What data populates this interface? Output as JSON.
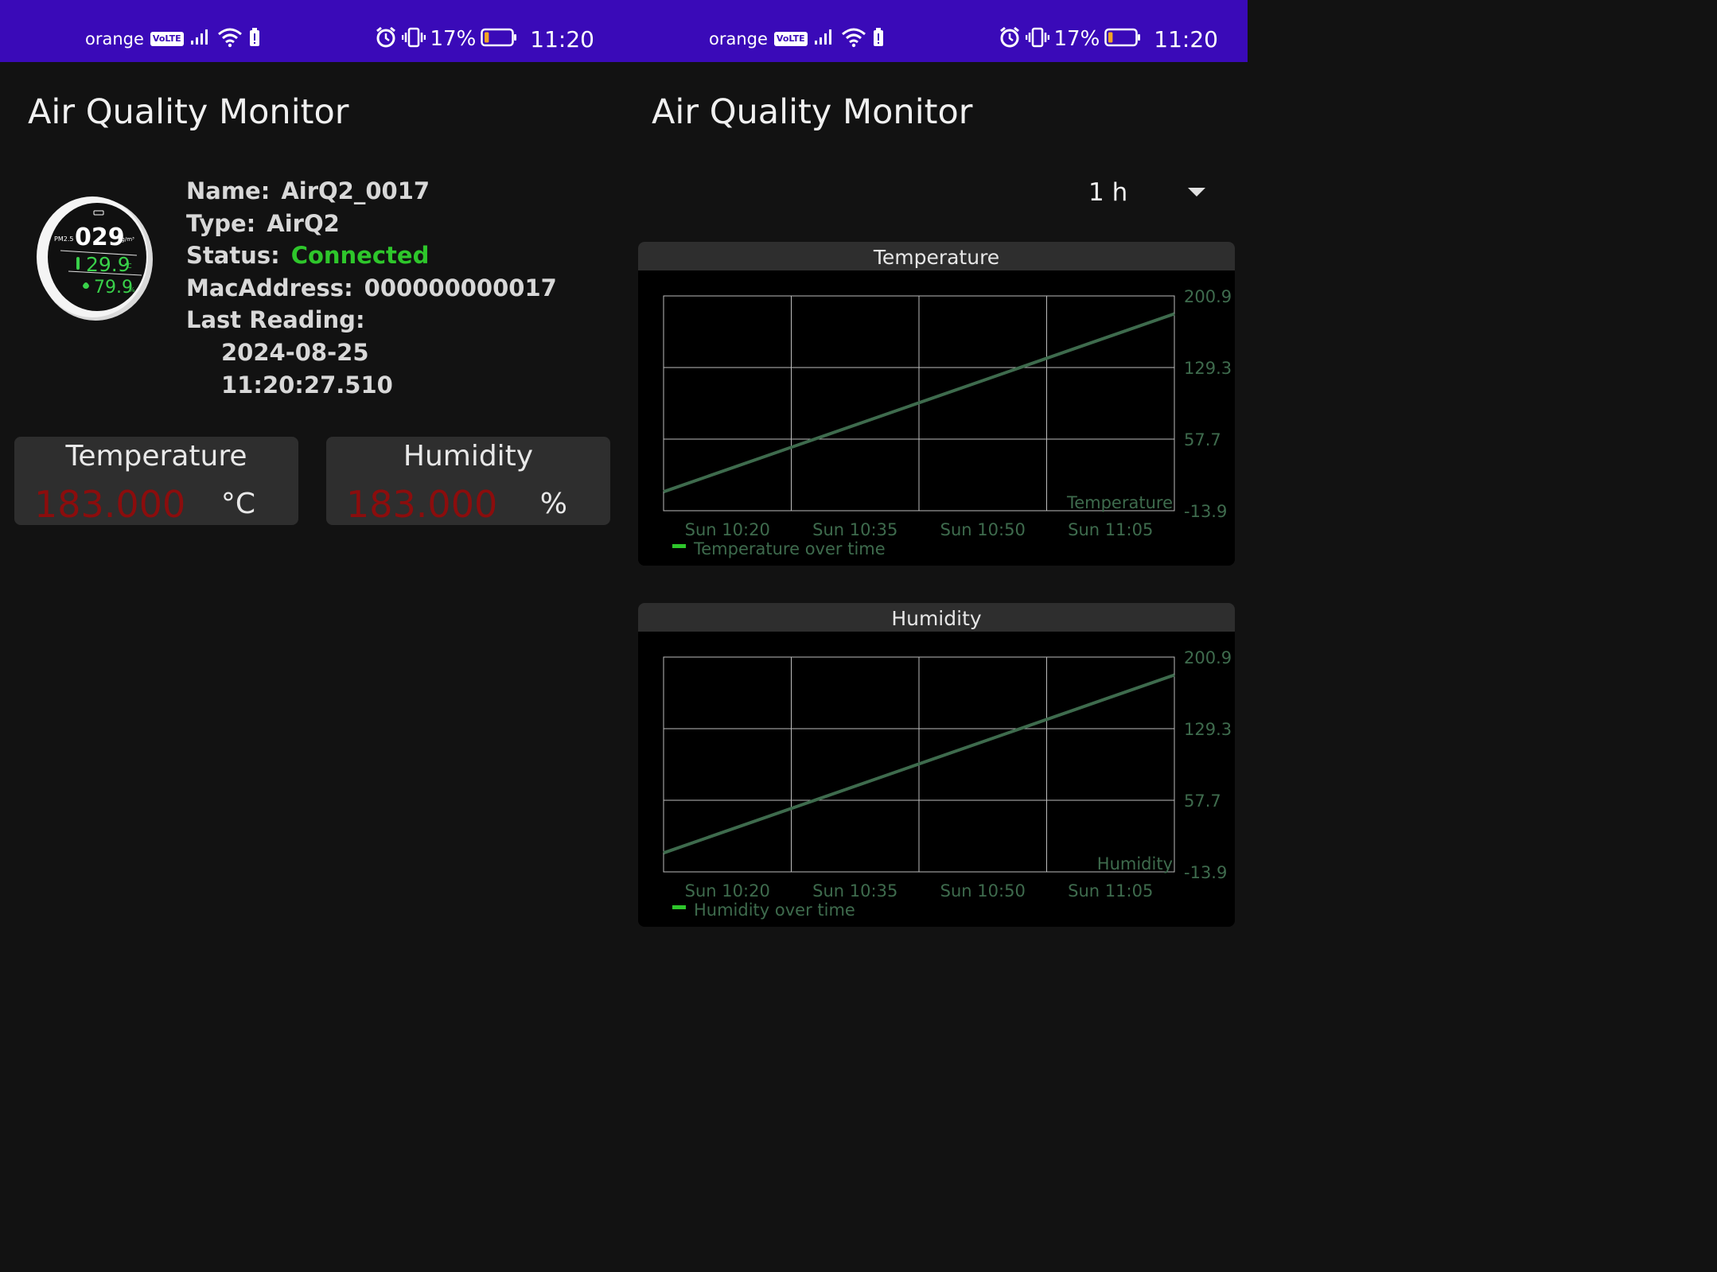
{
  "status_bar": {
    "carrier": "orange",
    "volte": "VoLTE",
    "battery_percent": "17%",
    "time": "11:20",
    "battery_level": 0.17,
    "icons": [
      "signal-icon",
      "wifi-icon",
      "battery-saver-icon",
      "alarm-icon",
      "vibrate-icon",
      "battery-icon"
    ]
  },
  "app": {
    "title": "Air Quality Monitor"
  },
  "device": {
    "name_label": "Name:",
    "name": "AirQ2_0017",
    "type_label": "Type:",
    "type": "AirQ2",
    "status_label": "Status:",
    "status": "Connected",
    "mac_label": "MacAddress:",
    "mac": "000000000017",
    "last_reading_label": "Last Reading:",
    "last_reading_date": "2024-08-25",
    "last_reading_time": "11:20:27.510",
    "status_color": "#2ec62b",
    "image": {
      "pm_label": "PM2.5",
      "pm_value": "029",
      "pm_unit": "ug/m³",
      "temp_value": "29.9",
      "temp_unit": "°C",
      "humidity_value": "79.9",
      "humidity_unit": "%"
    }
  },
  "cards": {
    "temperature": {
      "title": "Temperature",
      "value": "183.000",
      "unit": "°C"
    },
    "humidity": {
      "title": "Humidity",
      "value": "183.000",
      "unit": "%"
    },
    "value_color": "#8b0d0d"
  },
  "range_select": {
    "value": "1 h"
  },
  "chart_data": [
    {
      "type": "line",
      "title": "Temperature",
      "x_ticks": [
        "Sun 10:20",
        "Sun 10:35",
        "Sun 10:50",
        "Sun 11:05"
      ],
      "y_ticks": [
        "200.9",
        "129.3",
        "57.7",
        "-13.9"
      ],
      "ylim": [
        -13.9,
        200.9
      ],
      "xlim": [
        "Sun 10:20",
        "Sun 11:20"
      ],
      "series": [
        {
          "name": "Temperature",
          "x": [
            "Sun 10:20",
            "Sun 11:20"
          ],
          "values": [
            5.0,
            183.0
          ],
          "color": "#3e6b4d"
        }
      ],
      "series_label": "Temperature",
      "legend": "Temperature over time",
      "legend_position": "bottom-left",
      "legend_color": "#2ec62b",
      "grid": true
    },
    {
      "type": "line",
      "title": "Humidity",
      "x_ticks": [
        "Sun 10:20",
        "Sun 10:35",
        "Sun 10:50",
        "Sun 11:05"
      ],
      "y_ticks": [
        "200.9",
        "129.3",
        "57.7",
        "-13.9"
      ],
      "ylim": [
        -13.9,
        200.9
      ],
      "xlim": [
        "Sun 10:20",
        "Sun 11:20"
      ],
      "series": [
        {
          "name": "Humidity",
          "x": [
            "Sun 10:20",
            "Sun 11:20"
          ],
          "values": [
            5.0,
            183.0
          ],
          "color": "#3e6b4d"
        }
      ],
      "series_label": "Humidity",
      "legend": "Humidity over time",
      "legend_position": "bottom-left",
      "legend_color": "#2ec62b",
      "grid": true
    }
  ]
}
